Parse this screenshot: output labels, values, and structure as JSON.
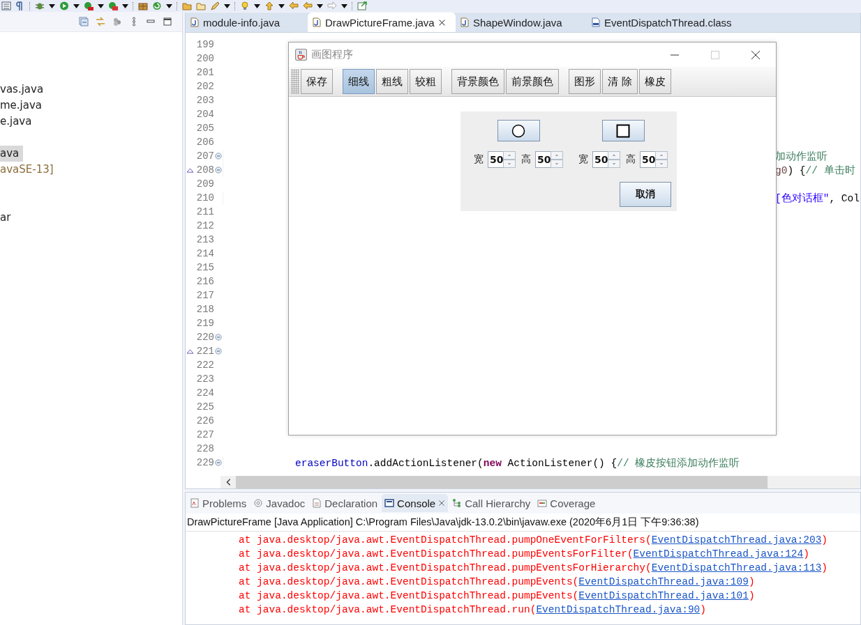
{
  "explorer": {
    "items": [
      {
        "label": "vas.java",
        "selected": false,
        "kind": "file"
      },
      {
        "label": "me.java",
        "selected": false,
        "kind": "file"
      },
      {
        "label": "e.java",
        "selected": false,
        "kind": "file"
      },
      {
        "label": "ava",
        "selected": true,
        "kind": "file"
      },
      {
        "label": "avaSE-13]",
        "selected": false,
        "kind": "library"
      },
      {
        "label": "ar",
        "selected": false,
        "kind": "file"
      }
    ]
  },
  "editor": {
    "tabs": [
      {
        "label": "module-info.java",
        "selected": false,
        "kind": "java"
      },
      {
        "label": "DrawPictureFrame.java",
        "selected": true,
        "kind": "java"
      },
      {
        "label": "ShapeWindow.java",
        "selected": false,
        "kind": "java"
      },
      {
        "label": "EventDispatchThread.class",
        "selected": false,
        "kind": "class"
      }
    ],
    "lines": [
      {
        "number": "199",
        "fold": false,
        "override": false
      },
      {
        "number": "200",
        "fold": false,
        "override": false
      },
      {
        "number": "201",
        "fold": false,
        "override": false
      },
      {
        "number": "202",
        "fold": false,
        "override": false
      },
      {
        "number": "203",
        "fold": false,
        "override": false
      },
      {
        "number": "204",
        "fold": false,
        "override": false
      },
      {
        "number": "205",
        "fold": false,
        "override": false
      },
      {
        "number": "206",
        "fold": false,
        "override": false
      },
      {
        "number": "207",
        "fold": true,
        "override": false,
        "kind": "tail",
        "segments": [
          {
            "kind": "comment",
            "text": "加动作监听"
          }
        ]
      },
      {
        "number": "208",
        "fold": true,
        "override": true,
        "kind": "tail",
        "segments": [
          {
            "kind": "param",
            "text": "g0"
          },
          {
            "kind": "plain",
            "text": ") {"
          },
          {
            "kind": "comment",
            "text": "// 单击时"
          }
        ]
      },
      {
        "number": "209",
        "fold": false,
        "override": false
      },
      {
        "number": "210",
        "fold": false,
        "override": false,
        "kind": "tail",
        "segments": [
          {
            "kind": "string",
            "text": "[色对话框\""
          },
          {
            "kind": "plain",
            "text": ", Col"
          }
        ]
      },
      {
        "number": "211",
        "fold": false,
        "override": false
      },
      {
        "number": "212",
        "fold": false,
        "override": false
      },
      {
        "number": "213",
        "fold": false,
        "override": false
      },
      {
        "number": "214",
        "fold": false,
        "override": false
      },
      {
        "number": "215",
        "fold": false,
        "override": false
      },
      {
        "number": "216",
        "fold": false,
        "override": false
      },
      {
        "number": "217",
        "fold": false,
        "override": false
      },
      {
        "number": "218",
        "fold": false,
        "override": false
      },
      {
        "number": "219",
        "fold": false,
        "override": false
      },
      {
        "number": "220",
        "fold": true,
        "override": false
      },
      {
        "number": "221",
        "fold": true,
        "override": true
      },
      {
        "number": "222",
        "fold": false,
        "override": false
      },
      {
        "number": "223",
        "fold": false,
        "override": false
      },
      {
        "number": "224",
        "fold": false,
        "override": false
      },
      {
        "number": "225",
        "fold": false,
        "override": false
      },
      {
        "number": "226",
        "fold": false,
        "override": false
      },
      {
        "number": "227",
        "fold": false,
        "override": false
      },
      {
        "number": "228",
        "fold": false,
        "override": false
      },
      {
        "number": "229",
        "fold": true,
        "override": false,
        "kind": "full",
        "segments": [
          {
            "kind": "field",
            "text": "eraserButton"
          },
          {
            "kind": "plain",
            "text": ".addActionListener("
          },
          {
            "kind": "keyword",
            "text": "new"
          },
          {
            "kind": "plain",
            "text": " ActionListener() {"
          },
          {
            "kind": "comment",
            "text": "// 橡皮按钮添加动作监听"
          }
        ]
      }
    ]
  },
  "frame": {
    "title": "画图程序",
    "toolbar": [
      {
        "buttons": [
          {
            "label": "保存",
            "selected": false
          }
        ]
      },
      {
        "buttons": [
          {
            "label": "细线",
            "selected": true
          },
          {
            "label": "粗线",
            "selected": false
          },
          {
            "label": "较粗",
            "selected": false
          }
        ]
      },
      {
        "buttons": [
          {
            "label": "背景颜色",
            "selected": false
          },
          {
            "label": "前景颜色",
            "selected": false
          }
        ]
      },
      {
        "buttons": [
          {
            "label": "图形",
            "selected": false
          },
          {
            "label": "清 除",
            "selected": false
          },
          {
            "label": "橡皮",
            "selected": false
          }
        ]
      }
    ]
  },
  "dialog": {
    "groups": [
      {
        "kind": "circle",
        "width_label": "宽",
        "width_value": "50",
        "height_label": "高",
        "height_value": "50"
      },
      {
        "kind": "square",
        "width_label": "宽",
        "width_value": "50",
        "height_label": "高",
        "height_value": "50"
      }
    ],
    "cancel": "取消"
  },
  "bottom_panel": {
    "tabs": [
      {
        "label": "Problems",
        "selected": false,
        "kind": "problems"
      },
      {
        "label": "Javadoc",
        "selected": false,
        "kind": "javadoc"
      },
      {
        "label": "Declaration",
        "selected": false,
        "kind": "declaration"
      },
      {
        "label": "Console",
        "selected": true,
        "kind": "console"
      },
      {
        "label": "Call Hierarchy",
        "selected": false,
        "kind": "hierarchy"
      },
      {
        "label": "Coverage",
        "selected": false,
        "kind": "coverage"
      }
    ],
    "console_title": "DrawPictureFrame [Java Application] C:\\Program Files\\Java\\jdk-13.0.2\\bin\\javaw.exe (2020年6月1日 下午9:36:38)",
    "console_lines": [
      {
        "prefix": "at java.desktop/java.awt.EventDispatchThread.pumpOneEventForFilters(",
        "link": "EventDispatchThread.java:203",
        "suffix": ")"
      },
      {
        "prefix": "at java.desktop/java.awt.EventDispatchThread.pumpEventsForFilter(",
        "link": "EventDispatchThread.java:124",
        "suffix": ")"
      },
      {
        "prefix": "at java.desktop/java.awt.EventDispatchThread.pumpEventsForHierarchy(",
        "link": "EventDispatchThread.java:113",
        "suffix": ")"
      },
      {
        "prefix": "at java.desktop/java.awt.EventDispatchThread.pumpEvents(",
        "link": "EventDispatchThread.java:109",
        "suffix": ")"
      },
      {
        "prefix": "at java.desktop/java.awt.EventDispatchThread.pumpEvents(",
        "link": "EventDispatchThread.java:101",
        "suffix": ")"
      },
      {
        "prefix": "at java.desktop/java.awt.EventDispatchThread.run(",
        "link": "EventDispatchThread.java:90",
        "suffix": ")"
      }
    ]
  }
}
